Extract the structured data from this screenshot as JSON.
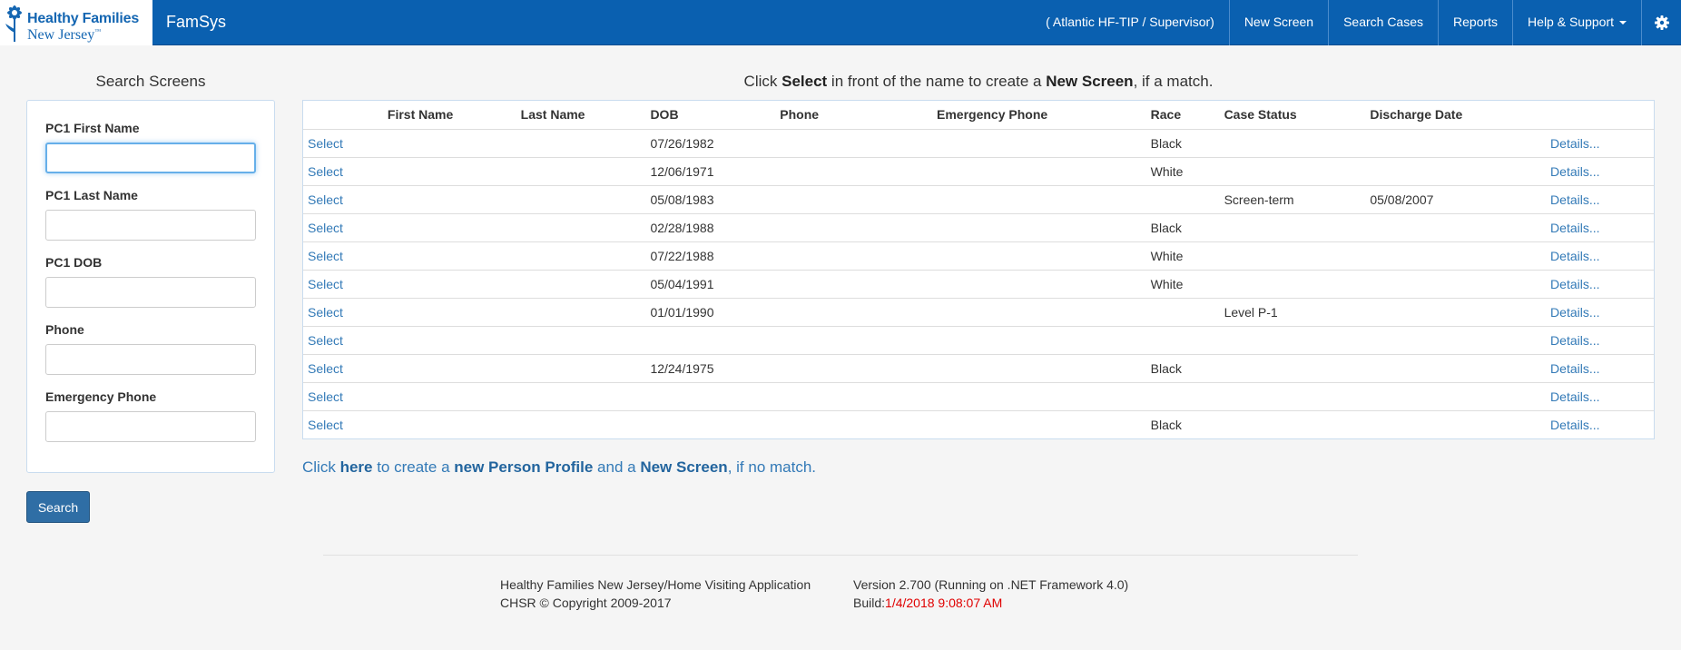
{
  "header": {
    "logo_line1": "Healthy Families",
    "logo_line2": "New Jersey",
    "logo_tm": "™",
    "brand": "FamSys",
    "context": "( Atlantic HF-TIP /  Supervisor)",
    "nav_items": [
      "New Screen",
      "Search Cases",
      "Reports",
      "Help & Support"
    ],
    "icon_settings": "gear-icon",
    "colors": {
      "navbar": "#0a60b0",
      "link": "#337ab7"
    }
  },
  "sidebar": {
    "title": "Search Screens",
    "fields": [
      {
        "label": "PC1 First Name",
        "value": "",
        "placeholder": ""
      },
      {
        "label": "PC1 Last Name",
        "value": "",
        "placeholder": ""
      },
      {
        "label": "PC1 DOB",
        "value": "",
        "placeholder": ""
      },
      {
        "label": "Phone",
        "value": "",
        "placeholder": ""
      },
      {
        "label": "Emergency Phone",
        "value": "",
        "placeholder": ""
      }
    ],
    "search_label": "Search"
  },
  "main": {
    "instruction": {
      "p1": "Click ",
      "b1": "Select",
      "p2": " in front of the name to create a ",
      "b2": "New Screen",
      "p3": ", if a match."
    },
    "columns": [
      "",
      "First Name",
      "Last Name",
      "DOB",
      "Phone",
      "Emergency Phone",
      "Race",
      "Case Status",
      "Discharge Date",
      ""
    ],
    "rows": [
      {
        "select": "Select",
        "first": "",
        "last": "",
        "dob": "07/26/1982",
        "phone": "",
        "emergency": "",
        "race": "Black",
        "status": "",
        "discharge": "",
        "details": "Details..."
      },
      {
        "select": "Select",
        "first": "",
        "last": "",
        "dob": "12/06/1971",
        "phone": "",
        "emergency": "",
        "race": "White",
        "status": "",
        "discharge": "",
        "details": "Details..."
      },
      {
        "select": "Select",
        "first": "",
        "last": "",
        "dob": "05/08/1983",
        "phone": "",
        "emergency": "",
        "race": "",
        "status": "Screen-term",
        "discharge": "05/08/2007",
        "details": "Details..."
      },
      {
        "select": "Select",
        "first": "",
        "last": "",
        "dob": "02/28/1988",
        "phone": "",
        "emergency": "",
        "race": "Black",
        "status": "",
        "discharge": "",
        "details": "Details..."
      },
      {
        "select": "Select",
        "first": "",
        "last": "",
        "dob": "07/22/1988",
        "phone": "",
        "emergency": "",
        "race": "White",
        "status": "",
        "discharge": "",
        "details": "Details..."
      },
      {
        "select": "Select",
        "first": "",
        "last": "",
        "dob": "05/04/1991",
        "phone": "",
        "emergency": "",
        "race": "White",
        "status": "",
        "discharge": "",
        "details": "Details..."
      },
      {
        "select": "Select",
        "first": "",
        "last": "",
        "dob": "01/01/1990",
        "phone": "",
        "emergency": "",
        "race": "",
        "status": "Level P-1",
        "discharge": "",
        "details": "Details..."
      },
      {
        "select": "Select",
        "first": "",
        "last": "",
        "dob": "",
        "phone": "",
        "emergency": "",
        "race": "",
        "status": "",
        "discharge": "",
        "details": "Details..."
      },
      {
        "select": "Select",
        "first": "",
        "last": "",
        "dob": "12/24/1975",
        "phone": "",
        "emergency": "",
        "race": "Black",
        "status": "",
        "discharge": "",
        "details": "Details..."
      },
      {
        "select": "Select",
        "first": "",
        "last": "",
        "dob": "",
        "phone": "",
        "emergency": "",
        "race": "",
        "status": "",
        "discharge": "",
        "details": "Details..."
      },
      {
        "select": "Select",
        "first": "",
        "last": "",
        "dob": "",
        "phone": "",
        "emergency": "",
        "race": "Black",
        "status": "",
        "discharge": "",
        "details": "Details..."
      }
    ],
    "no_match": {
      "p1": "Click ",
      "b1": "here",
      "p2": " to create a ",
      "b2": "new Person Profile",
      "p3": " and a ",
      "b3": "New Screen",
      "p4": ", if no match."
    }
  },
  "footer": {
    "app_name": "Healthy Families New Jersey/Home Visiting Application",
    "copyright": "CHSR © Copyright 2009-2017",
    "version": "Version 2.700 (Running on .NET Framework 4.0)",
    "build_label": "Build:",
    "build_value": "1/4/2018 9:08:07 AM"
  }
}
